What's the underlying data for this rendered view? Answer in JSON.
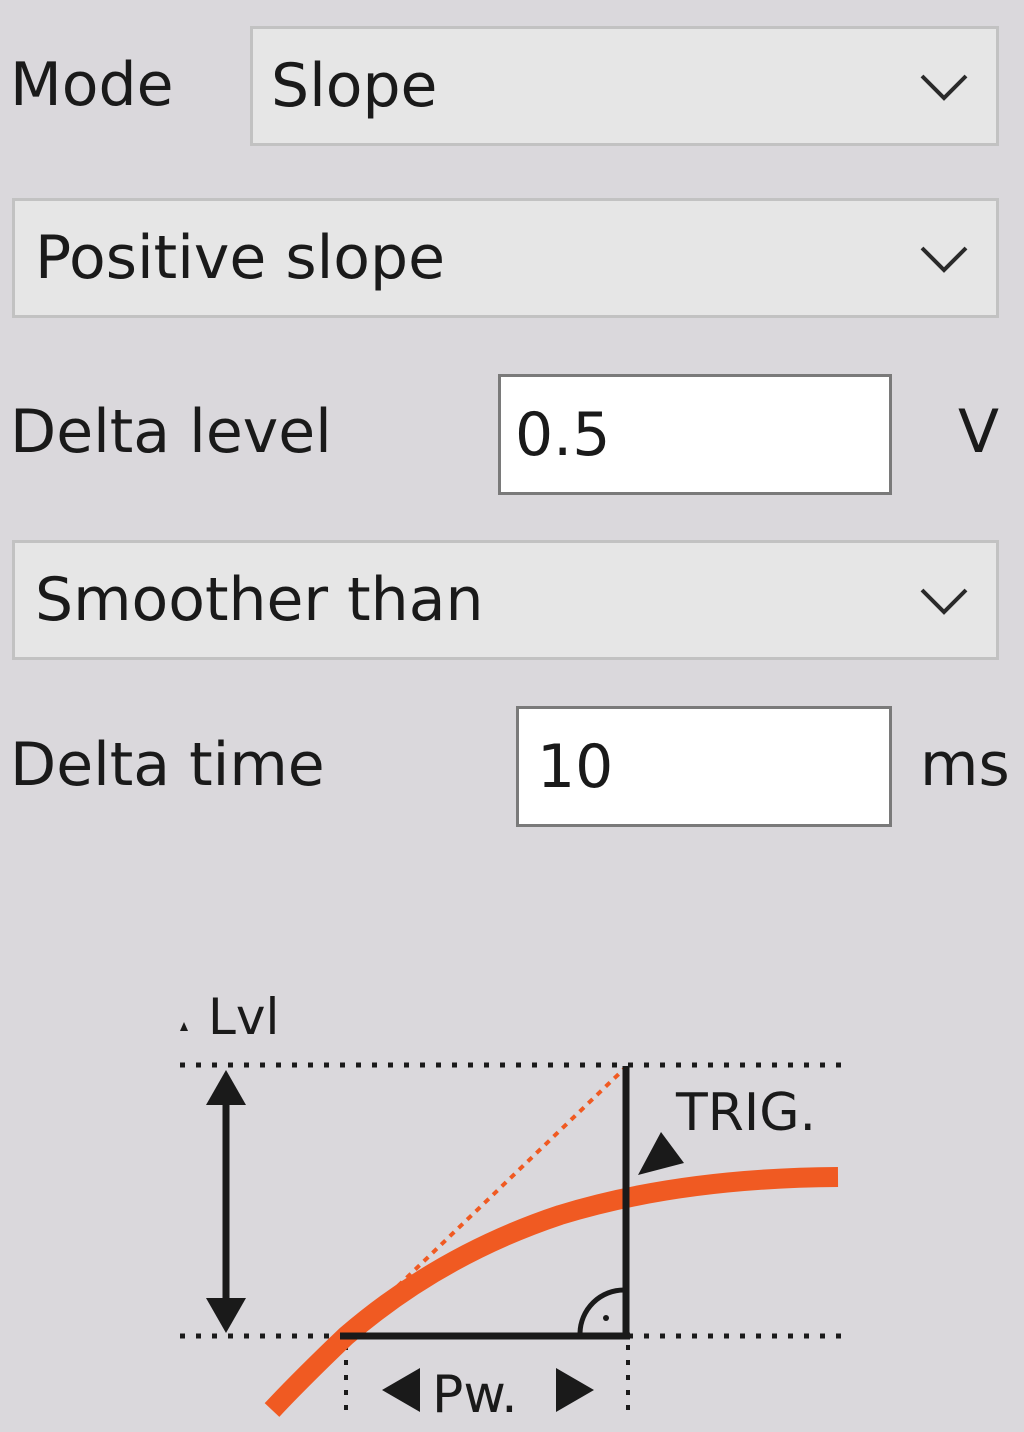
{
  "mode": {
    "label": "Mode",
    "selected": "Slope",
    "icon": "chevron-down-icon"
  },
  "slope_direction": {
    "selected": "Positive slope",
    "icon": "chevron-down-icon"
  },
  "delta_level": {
    "label": "Delta level",
    "value": "0.5",
    "unit": "V"
  },
  "comparison": {
    "selected": "Smoother than",
    "icon": "chevron-down-icon"
  },
  "delta_time": {
    "label": "Delta time",
    "value": "10",
    "unit": "ms"
  },
  "diagram": {
    "level_label": "Lvl",
    "trigger_label": "TRIG.",
    "pulse_width_label": "Pw.",
    "colors": {
      "signal": "#f05a22",
      "line": "#1a1a1a"
    }
  }
}
